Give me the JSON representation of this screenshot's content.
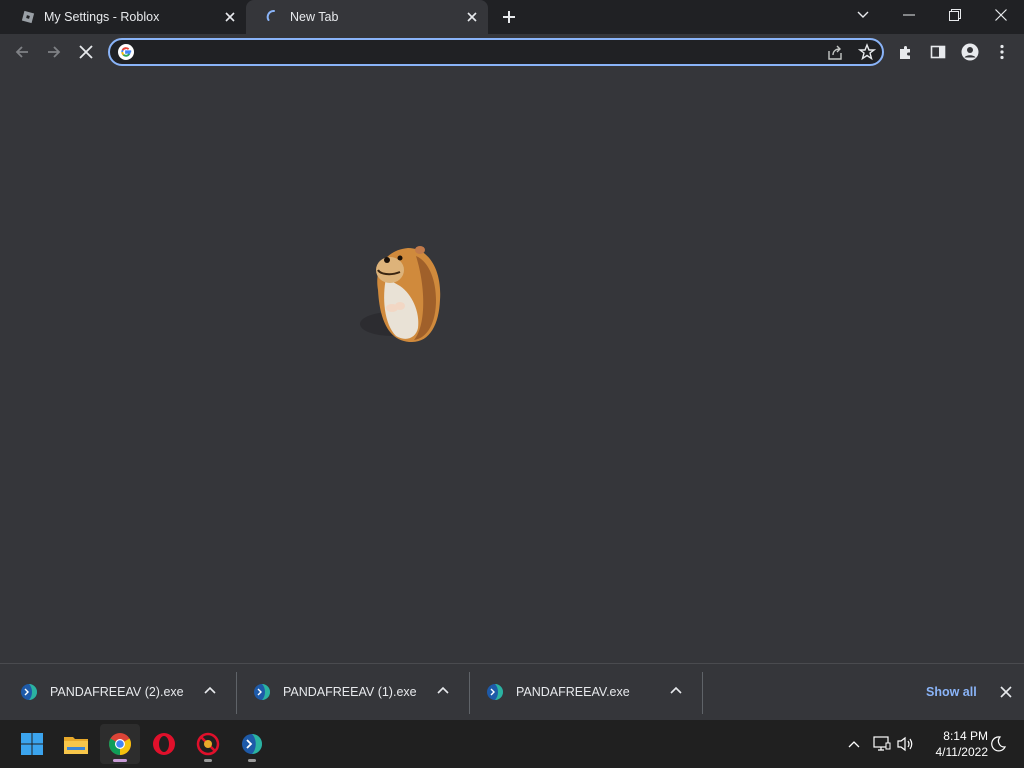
{
  "tabs": [
    {
      "title": "My Settings - Roblox",
      "favicon": "roblox-icon"
    },
    {
      "title": "New Tab",
      "favicon": "loading-spinner-icon"
    }
  ],
  "omnibox": {
    "value": "",
    "placeholder": ""
  },
  "downloads": [
    {
      "filename": "PANDAFREEAV (2).exe",
      "icon": "exe-file-icon"
    },
    {
      "filename": "PANDAFREEAV (1).exe",
      "icon": "exe-file-icon"
    },
    {
      "filename": "PANDAFREEAV.exe",
      "icon": "exe-file-icon"
    }
  ],
  "shelf": {
    "show_all_label": "Show all"
  },
  "taskbar": {
    "apps": [
      "start-icon",
      "file-explorer-icon",
      "chrome-icon",
      "opera-icon",
      "blocked-app-icon",
      "pandafreeav-icon"
    ],
    "time": "8:14 PM",
    "date": "4/11/2022"
  },
  "colors": {
    "accent": "#8ab4f8",
    "frame": "#202124",
    "toolbar": "#35363a"
  }
}
